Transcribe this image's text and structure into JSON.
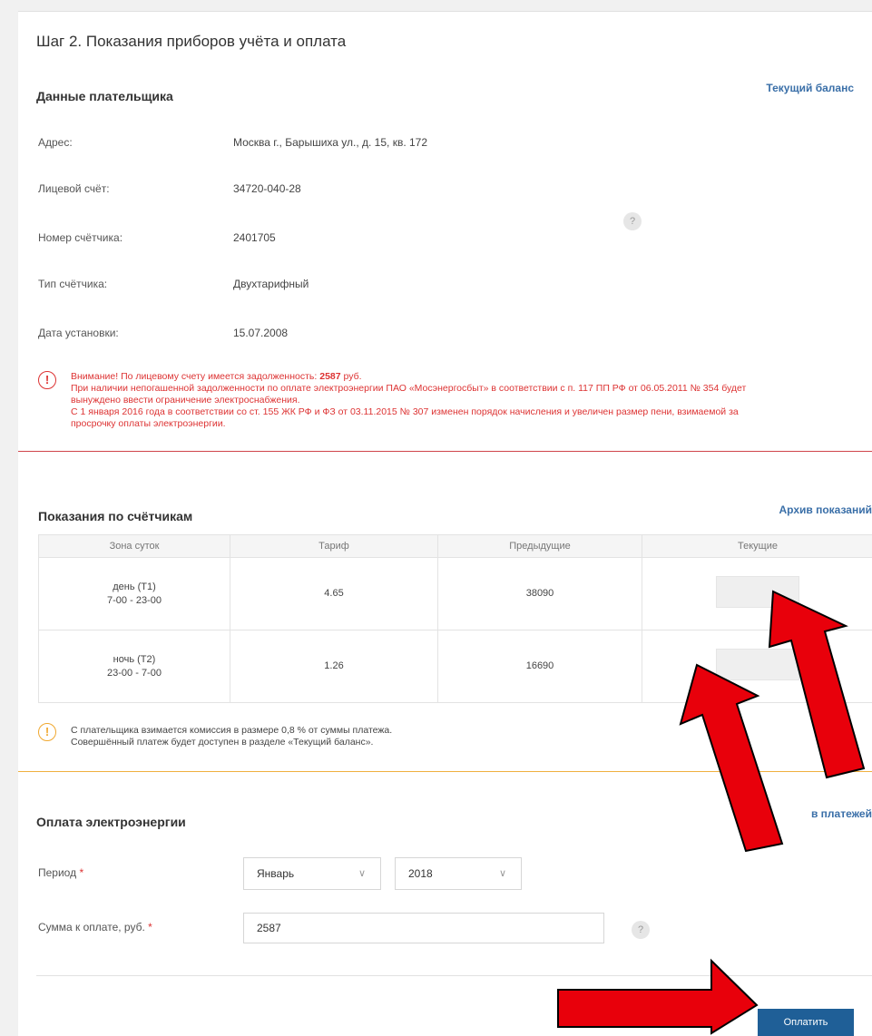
{
  "step_title": "Шаг 2. Показания приборов учёта и оплата",
  "payer": {
    "heading": "Данные плательщика",
    "balance_link": "Текущий баланс",
    "rows": [
      {
        "label": "Адрес:",
        "value": "Москва г., Барышиха ул., д. 15, кв. 172"
      },
      {
        "label": "Лицевой счёт:",
        "value": "34720-040-28"
      },
      {
        "label": "Номер счётчика:",
        "value": "2401705"
      },
      {
        "label": "Тип счётчика:",
        "value": "Двухтарифный"
      },
      {
        "label": "Дата установки:",
        "value": "15.07.2008"
      }
    ],
    "help_icon": "?"
  },
  "debt_warning": {
    "icon": "!",
    "line1_prefix": "Внимание! По лицевому счету имеется задолженность: ",
    "amount": "2587",
    "line1_suffix": " руб.",
    "line2": "При наличии непогашенной задолженности по оплате электроэнергии ПАО «Мосэнергосбыт» в соответствии с п. 117 ПП РФ от 06.05.2011 № 354 будет",
    "line3": "вынуждено ввести ограничение электроснабжения.",
    "line4": "С 1 января 2016 года в соответствии со ст. 155 ЖК РФ и ФЗ от 03.11.2015 № 307 изменен порядок начисления и увеличен размер пени, взимаемой за",
    "line5": "просрочку оплаты электроэнергии.",
    "color": "#d33333"
  },
  "meters": {
    "heading": "Показания по счётчикам",
    "archive_link": "Архив показаний",
    "columns": [
      "Зона суток",
      "Тариф",
      "Предыдущие",
      "Текущие"
    ],
    "rows": [
      {
        "zone": "день (Т1)",
        "hours": "7-00 - 23-00",
        "tariff": "4.65",
        "previous": "38090",
        "current": ""
      },
      {
        "zone": "ночь (Т2)",
        "hours": "23-00 - 7-00",
        "tariff": "1.26",
        "previous": "16690",
        "current": ""
      }
    ]
  },
  "commission_note": {
    "icon": "!",
    "line1": "С плательщика взимается комиссия в размере 0,8 % от суммы платежа.",
    "line2": "Совершённый платеж будет доступен в разделе «Текущий баланс»."
  },
  "payment": {
    "heading": "Оплата электроэнергии",
    "archive_link": "в платежей",
    "period_label": "Период",
    "month": "Январь",
    "year": "2018",
    "amount_label": "Сумма к оплате, руб.",
    "amount_value": "2587",
    "required_mark": "*",
    "pay_button": "Оплатить"
  },
  "colors": {
    "accent": "#1f5f97",
    "link": "#3a6fa8",
    "annotation_arrow": "#e8000b"
  }
}
